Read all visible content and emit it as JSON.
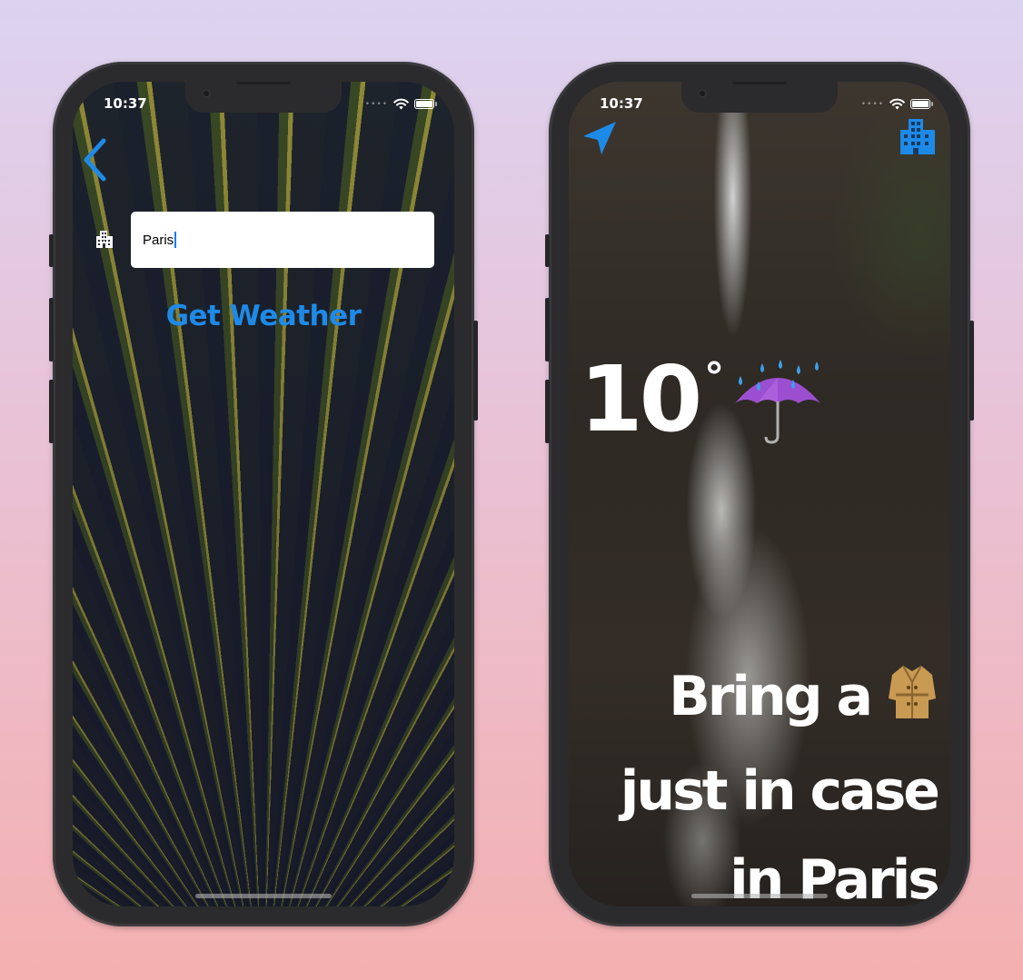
{
  "status_bar": {
    "time": "10:37"
  },
  "search_screen": {
    "search_value": "Paris",
    "get_weather_label": "Get Weather"
  },
  "weather_screen": {
    "temperature": "10",
    "degree_symbol": "°",
    "weather_condition_icon": "umbrella-with-rain-icon",
    "message_line1": "Bring a",
    "message_icon": "coat-icon",
    "message_line2": "just in case",
    "message_line3": "in Paris"
  },
  "colors": {
    "accent_blue": "#1e8ae8",
    "text_white": "#ffffff"
  }
}
